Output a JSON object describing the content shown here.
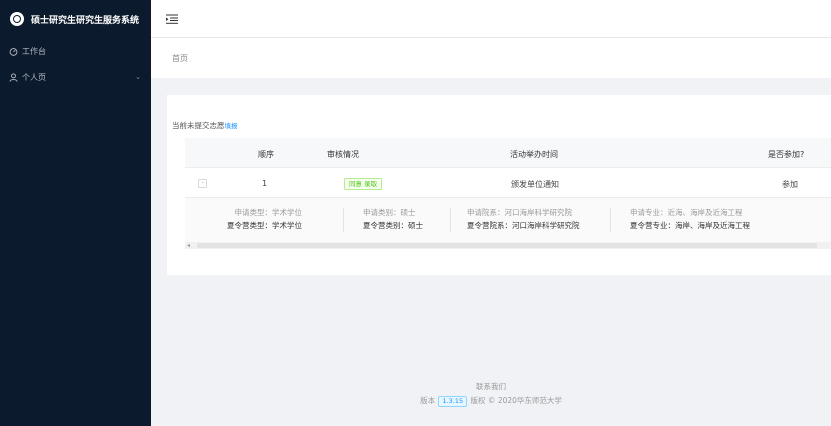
{
  "app": {
    "title": "硕士研究生研究生服务系统"
  },
  "sidebar": {
    "items": [
      {
        "label": "工作台",
        "icon": "dashboard-icon"
      },
      {
        "label": "个人页",
        "icon": "user-icon",
        "chevron": "⌄"
      }
    ]
  },
  "breadcrumb": {
    "home": "首页"
  },
  "notice": {
    "text": "当前未提交志愿",
    "link": "填报"
  },
  "table": {
    "columns": [
      "顺序",
      "审核情况",
      "活动举办时间",
      "是否参加?"
    ],
    "row": {
      "expand": "-",
      "order": "1",
      "status": "同意 录取",
      "activity_time": "颁发单位通知",
      "action": "参加"
    },
    "details": [
      {
        "l1": "申请类型：学术学位",
        "l2": "夏令营类型：学术学位"
      },
      {
        "l1": "申请类别：硕士",
        "l2": "夏令营类别：硕士"
      },
      {
        "l1": "申请院系：河口海岸科学研究院",
        "l2": "夏令营院系：河口海岸科学研究院"
      },
      {
        "l1": "申请专业：近海、海岸及近海工程",
        "l2": "夏令营专业：海岸、海岸及近海工程"
      }
    ]
  },
  "footer": {
    "contact": "联系我们",
    "version_prefix": "版本",
    "version": "1.3.15",
    "copyright": "版权 © 2020华东师范大学"
  },
  "colors": {
    "sidebar_bg": "#0b1a2c",
    "accent": "#1890ff",
    "success": "#52c41a"
  }
}
